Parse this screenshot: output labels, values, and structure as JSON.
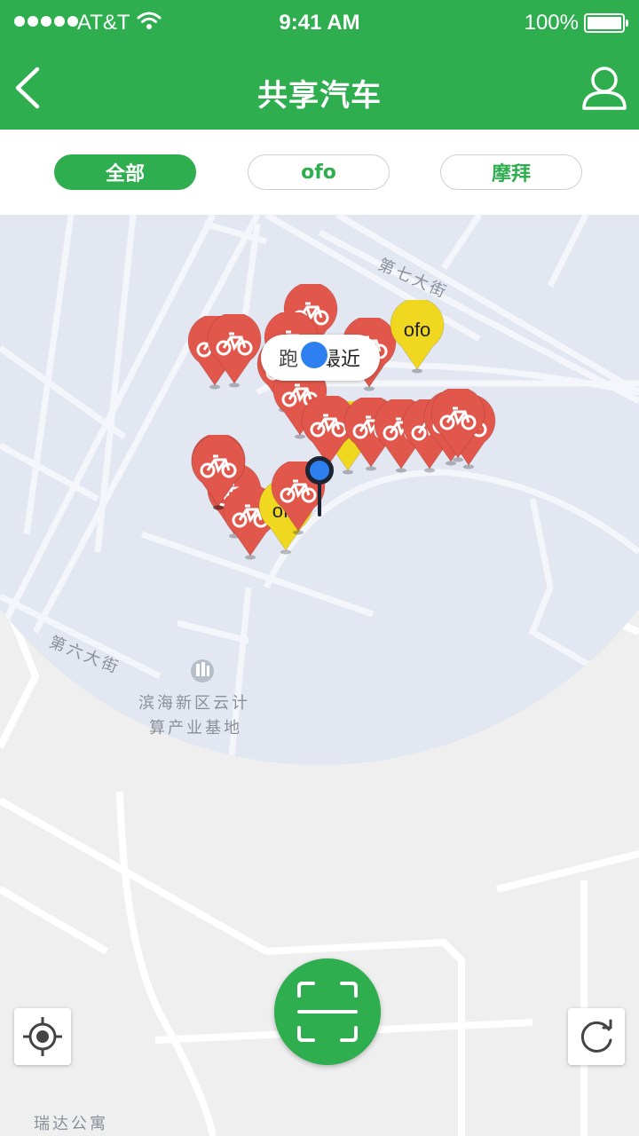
{
  "status_bar": {
    "carrier": "AT&T",
    "time": "9:41 AM",
    "battery": "100%"
  },
  "header": {
    "title": "共享汽车"
  },
  "filters": {
    "tabs": [
      {
        "label": "全部",
        "active": true
      },
      {
        "label": "ofo",
        "active": false
      },
      {
        "label": "摩拜",
        "active": false
      }
    ]
  },
  "map": {
    "streets": [
      "第七大街",
      "第六大街"
    ],
    "pois": [
      "滨海新区云计",
      "算产业基地",
      "瑞达公寓"
    ],
    "nearest_bubble": {
      "prefix": "跑",
      "label": "最近"
    },
    "brand_mark": "ofo"
  },
  "colors": {
    "brand_green": "#2eae4f",
    "mobike_red": "#e2574c",
    "ofo_yellow": "#f0d821",
    "location_blue": "#2e7ff0"
  },
  "icons": [
    "back-arrow-icon",
    "profile-icon",
    "locate-icon",
    "scan-icon",
    "refresh-icon"
  ]
}
